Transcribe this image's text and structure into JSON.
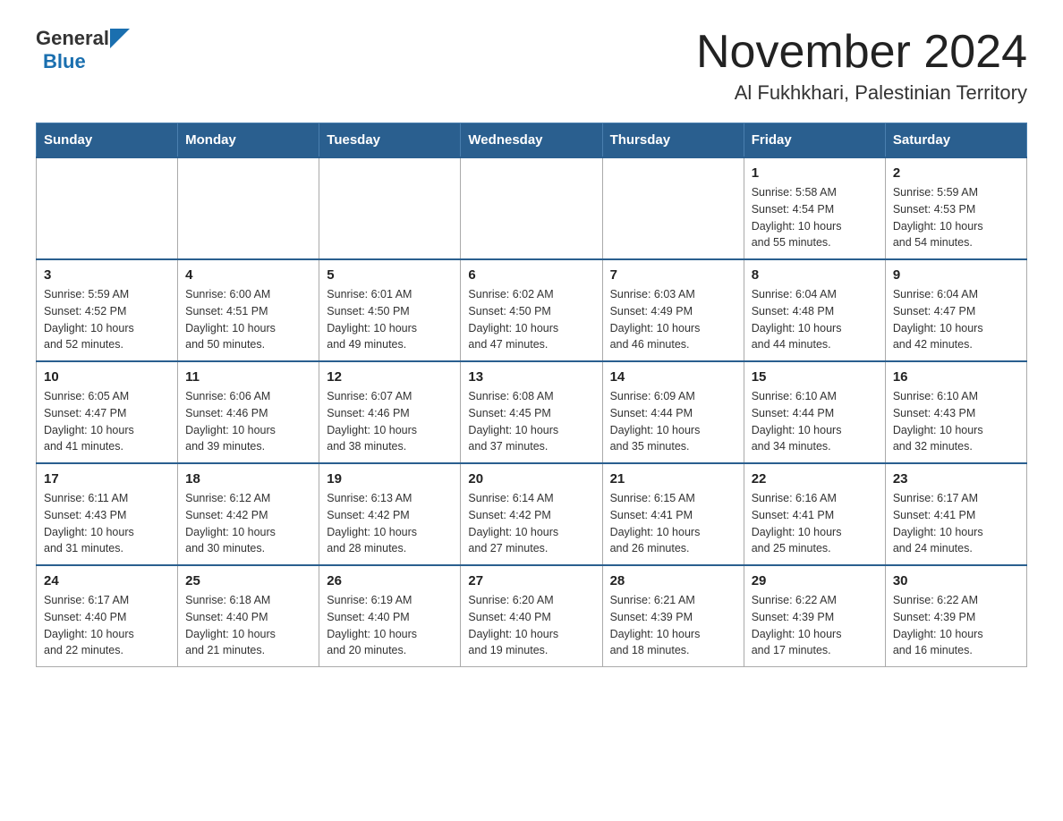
{
  "header": {
    "logo_general": "General",
    "logo_blue": "Blue",
    "month_title": "November 2024",
    "location": "Al Fukhkhari, Palestinian Territory"
  },
  "weekdays": [
    "Sunday",
    "Monday",
    "Tuesday",
    "Wednesday",
    "Thursday",
    "Friday",
    "Saturday"
  ],
  "weeks": [
    {
      "days": [
        {
          "number": "",
          "info": ""
        },
        {
          "number": "",
          "info": ""
        },
        {
          "number": "",
          "info": ""
        },
        {
          "number": "",
          "info": ""
        },
        {
          "number": "",
          "info": ""
        },
        {
          "number": "1",
          "info": "Sunrise: 5:58 AM\nSunset: 4:54 PM\nDaylight: 10 hours\nand 55 minutes."
        },
        {
          "number": "2",
          "info": "Sunrise: 5:59 AM\nSunset: 4:53 PM\nDaylight: 10 hours\nand 54 minutes."
        }
      ]
    },
    {
      "days": [
        {
          "number": "3",
          "info": "Sunrise: 5:59 AM\nSunset: 4:52 PM\nDaylight: 10 hours\nand 52 minutes."
        },
        {
          "number": "4",
          "info": "Sunrise: 6:00 AM\nSunset: 4:51 PM\nDaylight: 10 hours\nand 50 minutes."
        },
        {
          "number": "5",
          "info": "Sunrise: 6:01 AM\nSunset: 4:50 PM\nDaylight: 10 hours\nand 49 minutes."
        },
        {
          "number": "6",
          "info": "Sunrise: 6:02 AM\nSunset: 4:50 PM\nDaylight: 10 hours\nand 47 minutes."
        },
        {
          "number": "7",
          "info": "Sunrise: 6:03 AM\nSunset: 4:49 PM\nDaylight: 10 hours\nand 46 minutes."
        },
        {
          "number": "8",
          "info": "Sunrise: 6:04 AM\nSunset: 4:48 PM\nDaylight: 10 hours\nand 44 minutes."
        },
        {
          "number": "9",
          "info": "Sunrise: 6:04 AM\nSunset: 4:47 PM\nDaylight: 10 hours\nand 42 minutes."
        }
      ]
    },
    {
      "days": [
        {
          "number": "10",
          "info": "Sunrise: 6:05 AM\nSunset: 4:47 PM\nDaylight: 10 hours\nand 41 minutes."
        },
        {
          "number": "11",
          "info": "Sunrise: 6:06 AM\nSunset: 4:46 PM\nDaylight: 10 hours\nand 39 minutes."
        },
        {
          "number": "12",
          "info": "Sunrise: 6:07 AM\nSunset: 4:46 PM\nDaylight: 10 hours\nand 38 minutes."
        },
        {
          "number": "13",
          "info": "Sunrise: 6:08 AM\nSunset: 4:45 PM\nDaylight: 10 hours\nand 37 minutes."
        },
        {
          "number": "14",
          "info": "Sunrise: 6:09 AM\nSunset: 4:44 PM\nDaylight: 10 hours\nand 35 minutes."
        },
        {
          "number": "15",
          "info": "Sunrise: 6:10 AM\nSunset: 4:44 PM\nDaylight: 10 hours\nand 34 minutes."
        },
        {
          "number": "16",
          "info": "Sunrise: 6:10 AM\nSunset: 4:43 PM\nDaylight: 10 hours\nand 32 minutes."
        }
      ]
    },
    {
      "days": [
        {
          "number": "17",
          "info": "Sunrise: 6:11 AM\nSunset: 4:43 PM\nDaylight: 10 hours\nand 31 minutes."
        },
        {
          "number": "18",
          "info": "Sunrise: 6:12 AM\nSunset: 4:42 PM\nDaylight: 10 hours\nand 30 minutes."
        },
        {
          "number": "19",
          "info": "Sunrise: 6:13 AM\nSunset: 4:42 PM\nDaylight: 10 hours\nand 28 minutes."
        },
        {
          "number": "20",
          "info": "Sunrise: 6:14 AM\nSunset: 4:42 PM\nDaylight: 10 hours\nand 27 minutes."
        },
        {
          "number": "21",
          "info": "Sunrise: 6:15 AM\nSunset: 4:41 PM\nDaylight: 10 hours\nand 26 minutes."
        },
        {
          "number": "22",
          "info": "Sunrise: 6:16 AM\nSunset: 4:41 PM\nDaylight: 10 hours\nand 25 minutes."
        },
        {
          "number": "23",
          "info": "Sunrise: 6:17 AM\nSunset: 4:41 PM\nDaylight: 10 hours\nand 24 minutes."
        }
      ]
    },
    {
      "days": [
        {
          "number": "24",
          "info": "Sunrise: 6:17 AM\nSunset: 4:40 PM\nDaylight: 10 hours\nand 22 minutes."
        },
        {
          "number": "25",
          "info": "Sunrise: 6:18 AM\nSunset: 4:40 PM\nDaylight: 10 hours\nand 21 minutes."
        },
        {
          "number": "26",
          "info": "Sunrise: 6:19 AM\nSunset: 4:40 PM\nDaylight: 10 hours\nand 20 minutes."
        },
        {
          "number": "27",
          "info": "Sunrise: 6:20 AM\nSunset: 4:40 PM\nDaylight: 10 hours\nand 19 minutes."
        },
        {
          "number": "28",
          "info": "Sunrise: 6:21 AM\nSunset: 4:39 PM\nDaylight: 10 hours\nand 18 minutes."
        },
        {
          "number": "29",
          "info": "Sunrise: 6:22 AM\nSunset: 4:39 PM\nDaylight: 10 hours\nand 17 minutes."
        },
        {
          "number": "30",
          "info": "Sunrise: 6:22 AM\nSunset: 4:39 PM\nDaylight: 10 hours\nand 16 minutes."
        }
      ]
    }
  ]
}
